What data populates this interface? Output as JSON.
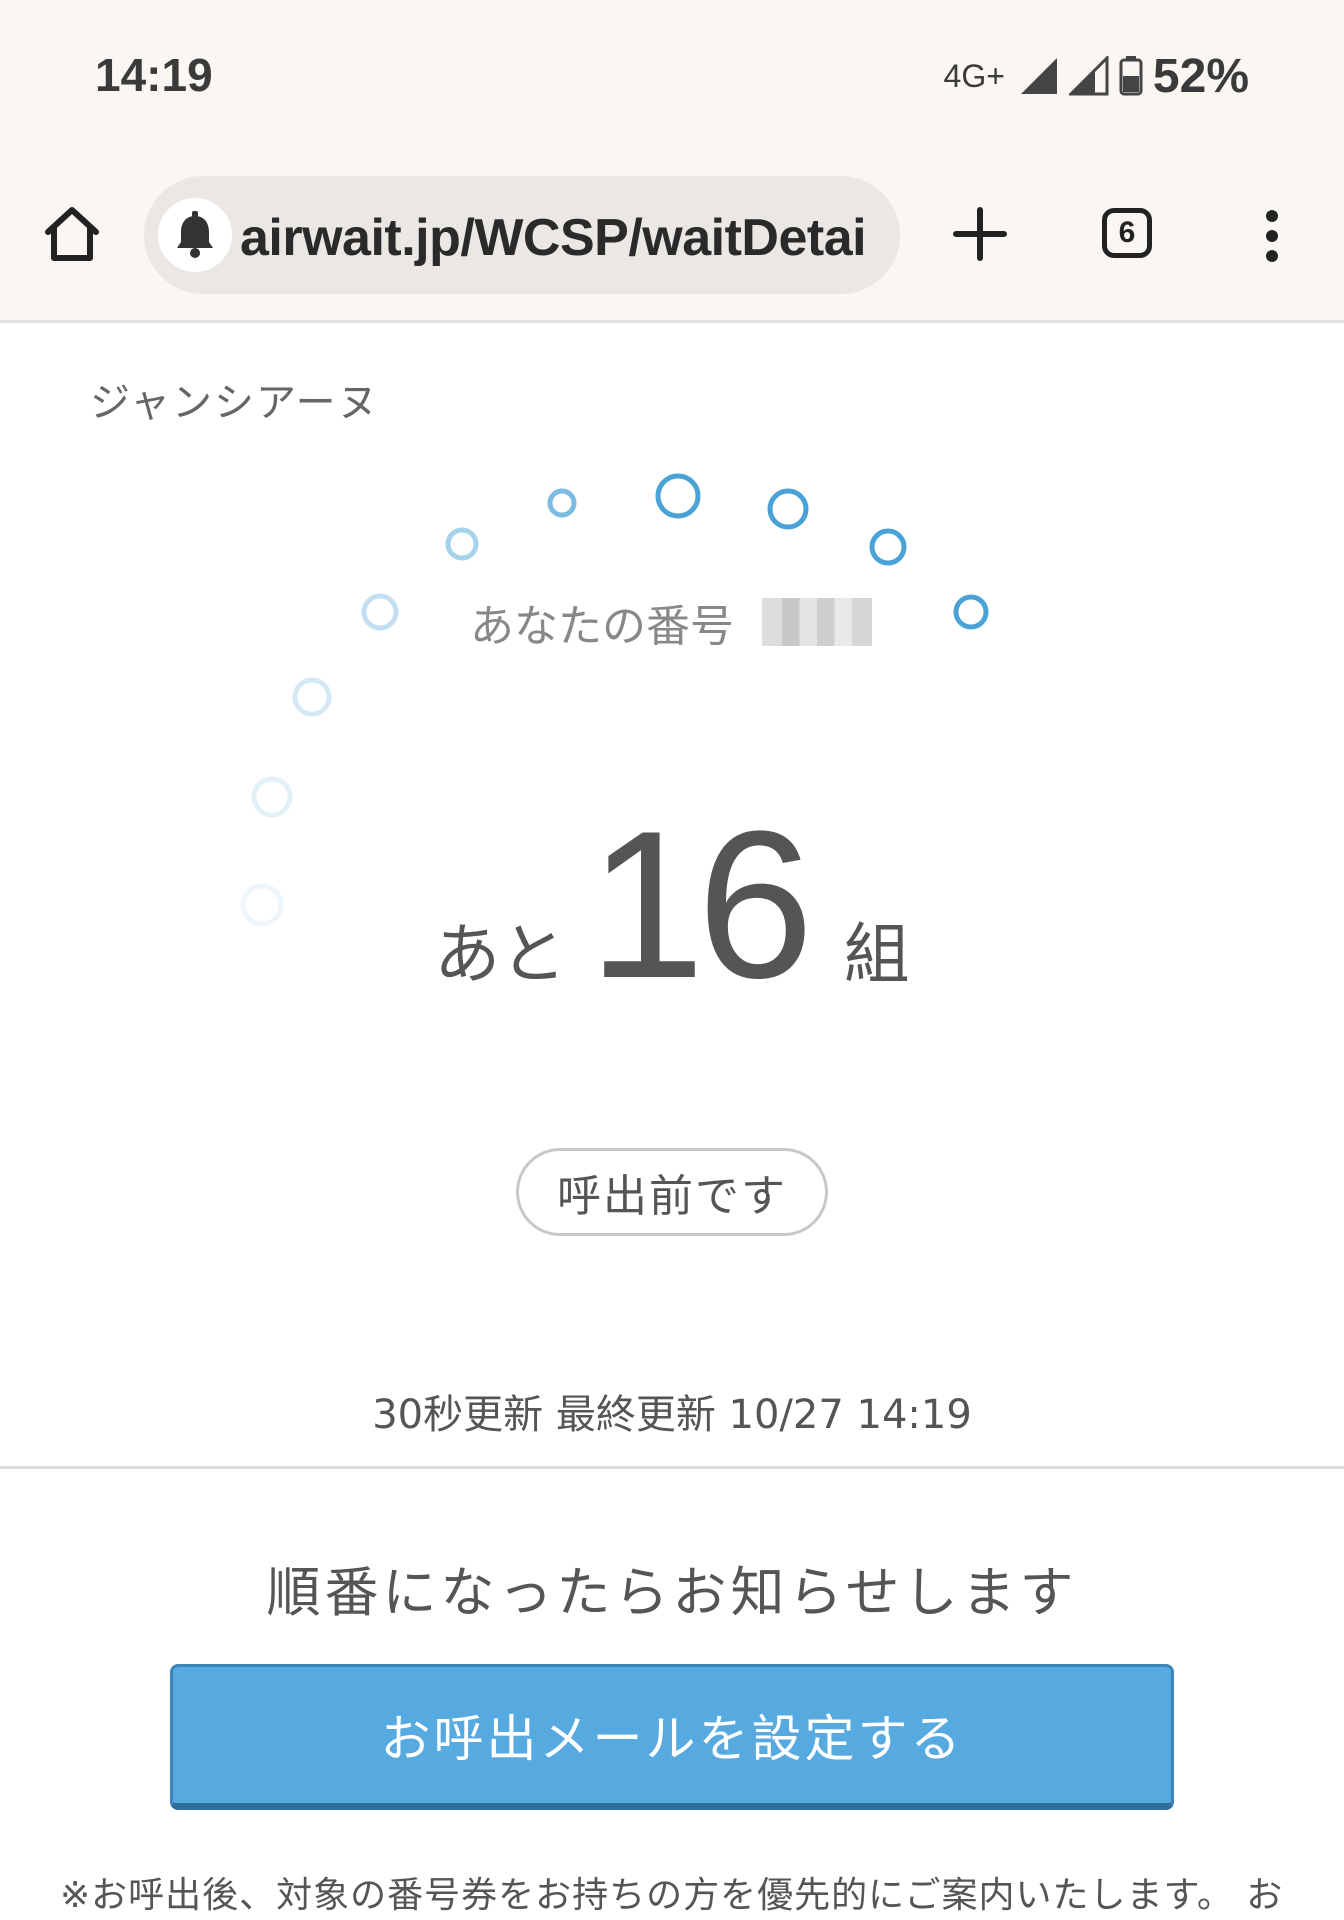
{
  "status_bar": {
    "time": "14:19",
    "network": "4G+",
    "battery": "52%",
    "icons": [
      "signal-icon",
      "signal-icon",
      "battery-icon"
    ]
  },
  "browser": {
    "url": "airwait.jp/WCSP/waitDetai",
    "tab_count": "6",
    "icons": [
      "home-icon",
      "bell-icon",
      "plus-icon",
      "tabs-icon",
      "more-vert-icon"
    ]
  },
  "main": {
    "store_name": "ジャンシアーヌ",
    "your_number_label": "あなたの番号",
    "remaining_prefix": "あと",
    "remaining_count": "16",
    "remaining_suffix": "組",
    "status_label": "呼出前です",
    "update_info": "30秒更新 最終更新 10/27 14:19",
    "notify_heading": "順番になったらお知らせします",
    "mail_button_label": "お呼出メールを設定する",
    "footnote": "※お呼出後、対象の番号券をお持ちの方を優先的にご案内いたします。 お"
  },
  "colors": {
    "accent": "#56aae0",
    "spinner": "#4aa3d6"
  }
}
